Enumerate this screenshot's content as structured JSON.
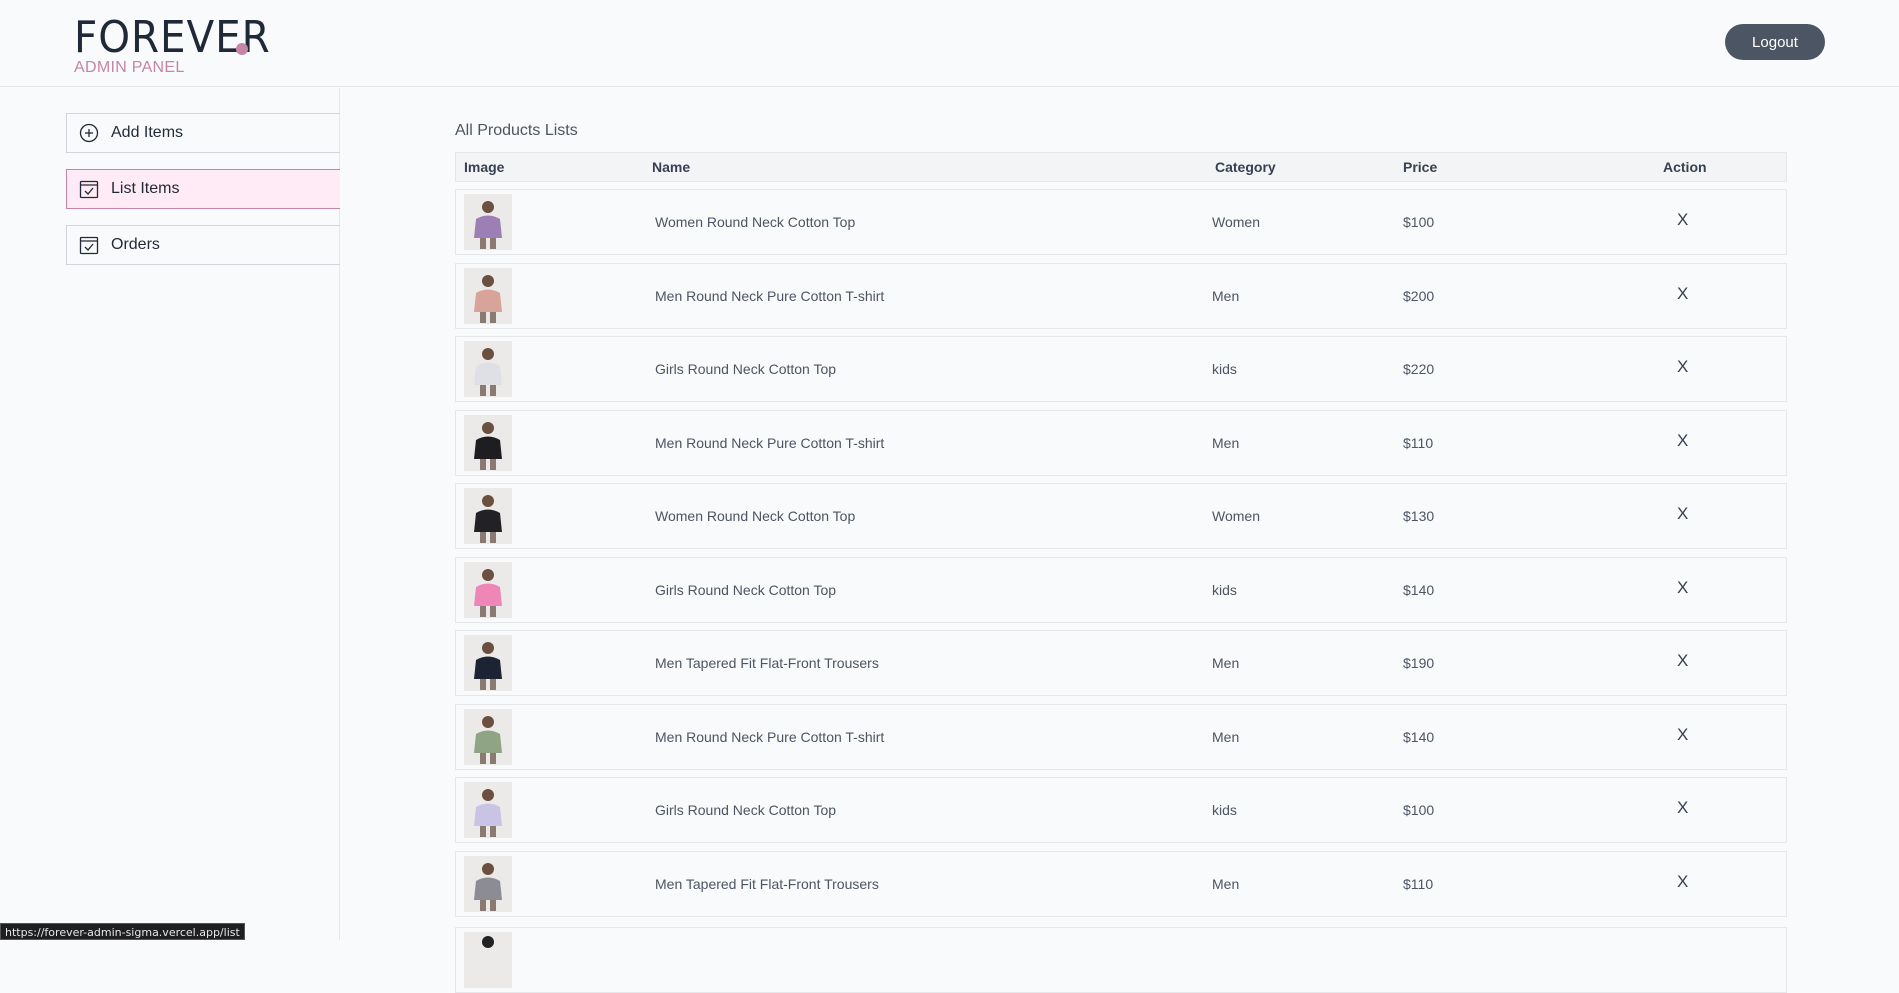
{
  "header": {
    "logo_text": "FOREVER",
    "subtitle": "ADMIN PANEL",
    "logout_label": "Logout",
    "brand_color": "#c586a5"
  },
  "sidebar": {
    "items": [
      {
        "label": "Add Items",
        "icon": "add-circle-icon"
      },
      {
        "label": "List Items",
        "icon": "calendar-check-icon",
        "active": true
      },
      {
        "label": "Orders",
        "icon": "calendar-check-icon"
      }
    ]
  },
  "main": {
    "title": "All Products Lists",
    "columns": [
      "Image",
      "Name",
      "Category",
      "Price",
      "Action"
    ],
    "rows": [
      {
        "name": "Women Round Neck Cotton Top",
        "category": "Women",
        "price": "$100",
        "action": "X",
        "thumb_color": "#9b7fb5"
      },
      {
        "name": "Men Round Neck Pure Cotton T-shirt",
        "category": "Men",
        "price": "$200",
        "action": "X",
        "thumb_color": "#d8a49a"
      },
      {
        "name": "Girls Round Neck Cotton Top",
        "category": "kids",
        "price": "$220",
        "action": "X",
        "thumb_color": "#dfe0e6"
      },
      {
        "name": "Men Round Neck Pure Cotton T-shirt",
        "category": "Men",
        "price": "$110",
        "action": "X",
        "thumb_color": "#1e1e22"
      },
      {
        "name": "Women Round Neck Cotton Top",
        "category": "Women",
        "price": "$130",
        "action": "X",
        "thumb_color": "#222226"
      },
      {
        "name": "Girls Round Neck Cotton Top",
        "category": "kids",
        "price": "$140",
        "action": "X",
        "thumb_color": "#ee86b8"
      },
      {
        "name": "Men Tapered Fit Flat-Front Trousers",
        "category": "Men",
        "price": "$190",
        "action": "X",
        "thumb_color": "#1c2333"
      },
      {
        "name": "Men Round Neck Pure Cotton T-shirt",
        "category": "Men",
        "price": "$140",
        "action": "X",
        "thumb_color": "#8fa385"
      },
      {
        "name": "Girls Round Neck Cotton Top",
        "category": "kids",
        "price": "$100",
        "action": "X",
        "thumb_color": "#c9c4e6"
      },
      {
        "name": "Men Tapered Fit Flat-Front Trousers",
        "category": "Men",
        "price": "$110",
        "action": "X",
        "thumb_color": "#8c8c94"
      }
    ]
  },
  "status_bar": {
    "url": "https://forever-admin-sigma.vercel.app/list"
  }
}
